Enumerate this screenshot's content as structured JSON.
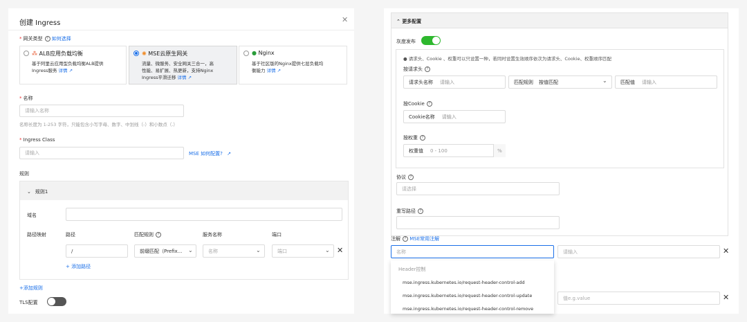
{
  "left": {
    "title": "创建 Ingress",
    "gateway_type_label": "网关类型",
    "how_to_choose": "如何选择",
    "cards": [
      {
        "name": "ALB应用负载均衡",
        "desc1": "基于阿里云应用型负载均衡ALB提供",
        "desc2": "Ingress服务",
        "detail": "详情"
      },
      {
        "name": "MSE云原生网关",
        "desc1": "流量、微服务、安全网关三合一，高",
        "desc2": "性能、易扩展、热更新，支持Nginx",
        "desc3": "Ingress平滑迁移",
        "detail": "详情"
      },
      {
        "name": "Nginx",
        "desc1": "基于社区版的Nginx提供七层负载均",
        "desc2": "衡能力",
        "detail": "详情"
      }
    ],
    "name_label": "名称",
    "name_placeholder": "请输入名称",
    "name_hint": "名称长度为 1-253 字符，只能包含小写字母、数字、中划线（-）和小数点（.）",
    "ingress_class_label": "Ingress Class",
    "ingress_class_placeholder": "请输入",
    "mse_how_config": "MSE 如何配置?",
    "rules_label": "规则",
    "rule1": "规则1",
    "domain_label": "域名",
    "path_mapping_label": "路径映射",
    "col_path": "路径",
    "col_match": "匹配规则",
    "col_service": "服务名称",
    "col_port": "端口",
    "path_value": "/",
    "match_value": "前缀匹配（Prefix...",
    "service_placeholder": "名称",
    "port_placeholder": "端口",
    "add_path": "添加路径",
    "add_rule": "+添加规则",
    "tls_label": "TLS配置"
  },
  "right": {
    "more_config": "更多配置",
    "canary_label": "灰度发布",
    "canary_note": "请求头、Cookie 、权重可以只设置一种，若同时设置生效顺序依次为请求头、Cookie、权重顺序匹配",
    "by_header": "按请求头",
    "header_name_label": "请求头名称",
    "header_name_placeholder": "请输入",
    "match_rule_label": "匹配规则",
    "match_rule_value": "按值匹配",
    "match_value_label": "匹配值",
    "match_value_placeholder": "请输入",
    "by_cookie": "按Cookie",
    "cookie_name_label": "Cookie名称",
    "cookie_placeholder": "请输入",
    "by_weight": "按权重",
    "weight_label": "权重值",
    "weight_placeholder": "0 - 100",
    "weight_unit": "%",
    "protocol_label": "协议",
    "protocol_placeholder": "请选择",
    "rewrite_label": "重写路径",
    "annotation_label": "注解",
    "mse_annotations": "MSE常用注解",
    "annotation_name_placeholder": "名称",
    "annotation_value_placeholder": "请输入",
    "value_placeholder": "值e.g.value",
    "dropdown_group": "Header控制",
    "dropdown_items": [
      "mse.ingress.kubernetes.io/request-header-control-add",
      "mse.ingress.kubernetes.io/request-header-control-update",
      "mse.ingress.kubernetes.io/request-header-control-remove"
    ]
  },
  "colors": {
    "accent": "#1a6fe8",
    "switch_on": "#2eb82e",
    "switch_off": "#555555"
  }
}
